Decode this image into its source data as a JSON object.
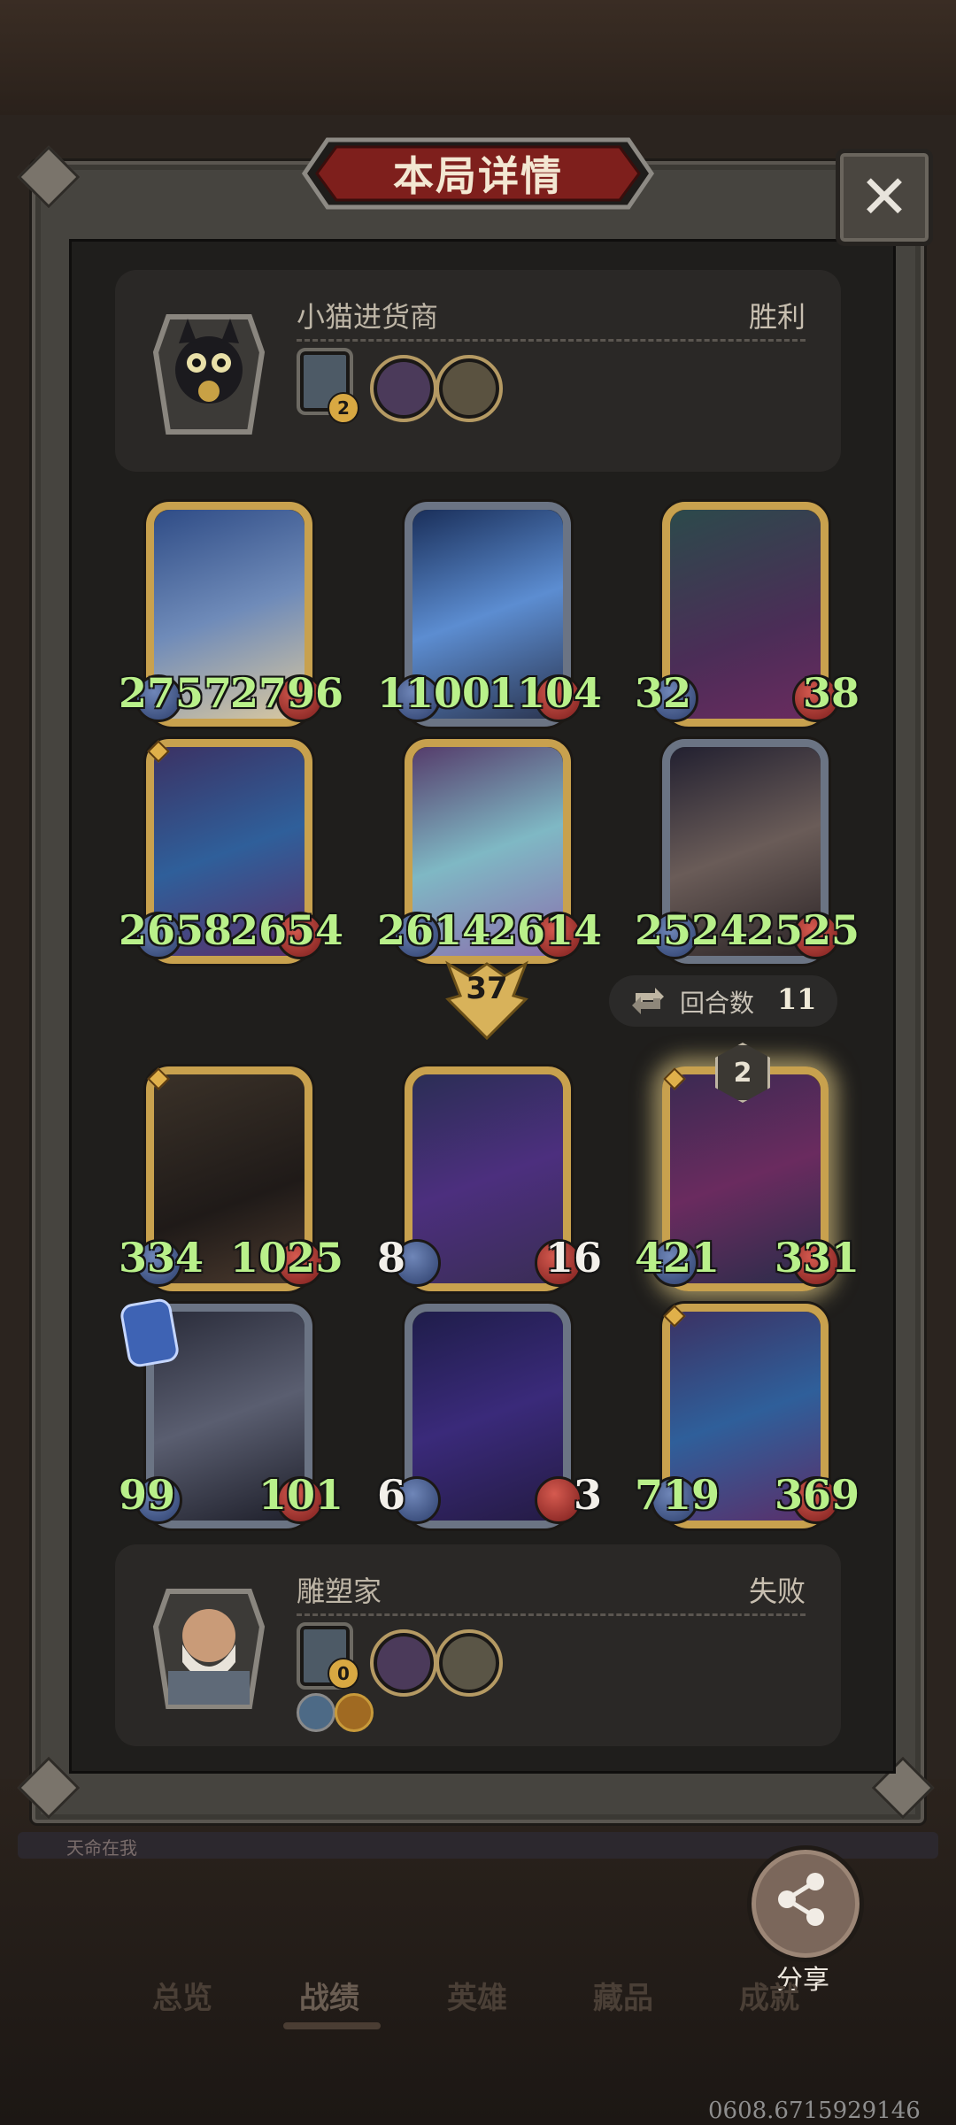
{
  "title": "本局详情",
  "close_icon": "close-icon",
  "players": {
    "top": {
      "name": "小猫进货商",
      "result": "胜利",
      "level_badge": "2"
    },
    "bottom": {
      "name": "雕塑家",
      "result": "失败",
      "level_badge": "0"
    }
  },
  "top_board": [
    {
      "atk": "2757",
      "hp": "2796",
      "name_hint": "king-hero"
    },
    {
      "atk": "1100",
      "hp": "1104",
      "name_hint": "crystal-beast"
    },
    {
      "atk": "32",
      "hp": "38",
      "name_hint": "elf-sorceress"
    },
    {
      "atk": "2658",
      "hp": "2654",
      "name_hint": "blue-hair-witch"
    },
    {
      "atk": "2614",
      "hp": "2614",
      "name_hint": "forest-maiden"
    },
    {
      "atk": "2524",
      "hp": "2525",
      "name_hint": "mushroom-spider"
    }
  ],
  "bottom_board": [
    {
      "atk": "334",
      "hp": "1025",
      "name_hint": "dragon"
    },
    {
      "atk": "8",
      "hp": "16",
      "name_hint": "star-wizard"
    },
    {
      "atk": "421",
      "hp": "331",
      "name_hint": "elf-sorceress"
    },
    {
      "atk": "99",
      "hp": "101",
      "name_hint": "moon-elf"
    },
    {
      "atk": "6",
      "hp": "3",
      "name_hint": "cosmic-bull"
    },
    {
      "atk": "719",
      "hp": "369",
      "name_hint": "blue-hair-witch"
    }
  ],
  "damage_marker": "37",
  "rounds": {
    "label": "回合数",
    "count": "11"
  },
  "level_badge_card": "2",
  "share": {
    "label": "分享"
  },
  "strip_text": "天命在我",
  "tabs": [
    "总览",
    "战绩",
    "英雄",
    "藏品",
    "成就"
  ],
  "uid": "0608.6715929146",
  "colors": {
    "gold_frame": "#c8a14e",
    "silver_frame": "#6b7484",
    "stat_green": "#b9f08a"
  }
}
